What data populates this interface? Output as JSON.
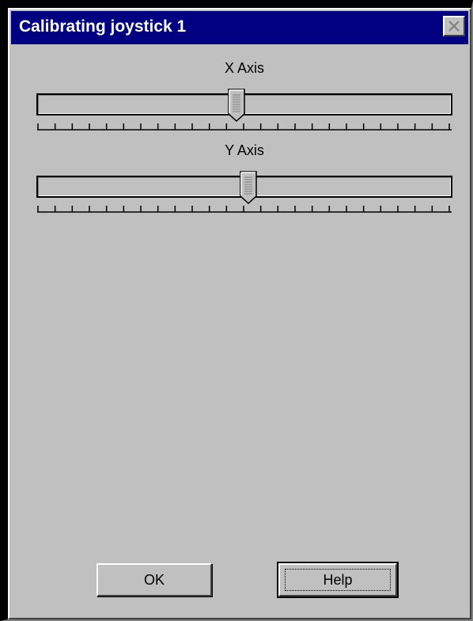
{
  "window": {
    "title": "Calibrating joystick 1"
  },
  "axes": [
    {
      "label": "X Axis",
      "position": 0.48,
      "tick_count": 25
    },
    {
      "label": "Y Axis",
      "position": 0.51,
      "tick_count": 25
    }
  ],
  "buttons": {
    "ok_label": "OK",
    "help_label": "Help"
  },
  "colors": {
    "title_bar": "#000080",
    "face": "#c0c0c0"
  }
}
